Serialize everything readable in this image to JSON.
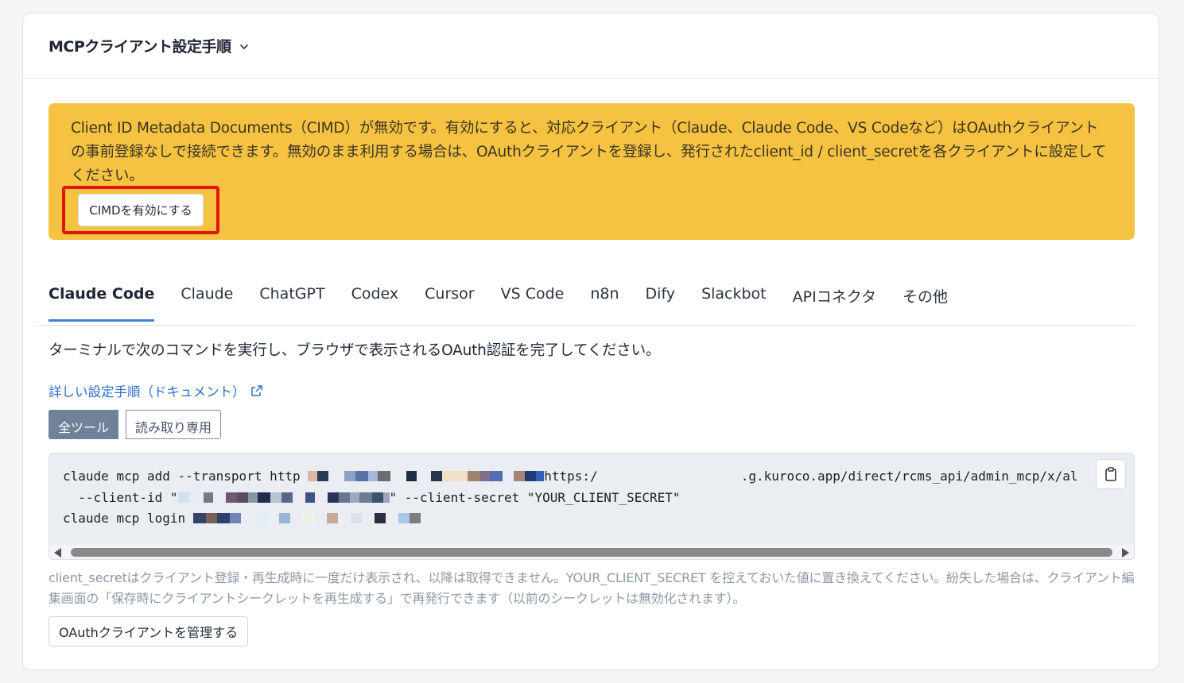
{
  "header": {
    "title": "MCPクライアント設定手順",
    "chevron_icon": "chevron-down-icon"
  },
  "notice": {
    "text": "Client ID Metadata Documents（CIMD）が無効です。有効にすると、対応クライアント（Claude、Claude Code、VS Codeなど）はOAuthクライアントの事前登録なしで接続できます。無効のまま利用する場合は、OAuthクライアントを登録し、発行されたclient_id / client_secretを各クライアントに設定してください。",
    "enable_button": "CIMDを有効にする",
    "bg_color": "#f5c242",
    "highlight_color": "#e3150f"
  },
  "tabs": [
    {
      "label": "Claude Code",
      "active": true
    },
    {
      "label": "Claude",
      "active": false
    },
    {
      "label": "ChatGPT",
      "active": false
    },
    {
      "label": "Codex",
      "active": false
    },
    {
      "label": "Cursor",
      "active": false
    },
    {
      "label": "VS Code",
      "active": false
    },
    {
      "label": "n8n",
      "active": false
    },
    {
      "label": "Dify",
      "active": false
    },
    {
      "label": "Slackbot",
      "active": false
    },
    {
      "label": "APIコネクタ",
      "active": false
    },
    {
      "label": "その他",
      "active": false
    }
  ],
  "instruction": "ターミナルで次のコマンドを実行し、ブラウザで表示されるOAuth認証を完了してください。",
  "doc_link": {
    "label": "詳しい設定手順（ドキュメント）",
    "icon": "external-link-icon"
  },
  "mode_toggle": {
    "all_tools": "全ツール",
    "read_only": "読み取り専用",
    "selected": "全ツール"
  },
  "code": {
    "line1_prefix": "claude mcp add --transport http ",
    "line1_url_start": "https:/",
    "line1_url_end": ".g.kuroco.app/direct/rcms_api/admin_mcp/x/al",
    "line2_prefix": "  --client-id \"",
    "line2_suffix": "\" --client-secret \"YOUR_CLIENT_SECRET\"",
    "line3_prefix": "claude mcp login ",
    "copy_icon": "clipboard-icon"
  },
  "note": "client_secretはクライアント登録・再生成時に一度だけ表示され、以降は取得できません。YOUR_CLIENT_SECRET を控えておいた値に置き換えてください。紛失した場合は、クライアント編集画面の「保存時にクライアントシークレットを再生成する」で再発行できます（以前のシークレットは無効化されます）。",
  "manage_button": "OAuthクライアントを管理する",
  "colors": {
    "accent": "#3c7dd8",
    "link": "#2f6fce",
    "toggle_active": "#6f8299"
  }
}
